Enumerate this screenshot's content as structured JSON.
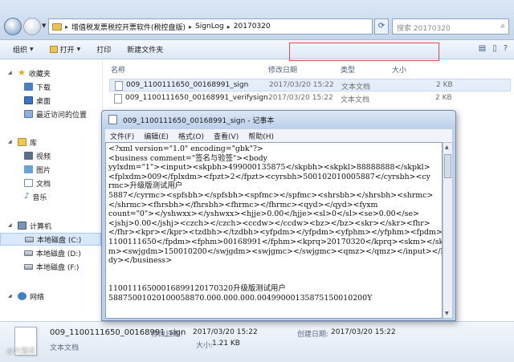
{
  "address": {
    "segments": [
      "增值税发票税控开票软件(税控盘版)",
      "SignLog",
      "20170320"
    ],
    "search_placeholder": "搜索 20170320"
  },
  "toolbar": {
    "organize": "组织",
    "open": "打开",
    "print": "打印",
    "new_folder": "新建文件夹"
  },
  "sidebar": {
    "favorites": "收藏夹",
    "downloads": "下载",
    "desktop": "桌面",
    "recent": "最近访问的位置",
    "libraries": "库",
    "videos": "视频",
    "pictures": "图片",
    "documents": "文档",
    "music": "音乐",
    "computer": "计算机",
    "drive_c": "本地磁盘 (C:)",
    "drive_d": "本地磁盘 (D:)",
    "drive_f": "本地磁盘 (F:)",
    "network": "网络"
  },
  "columns": {
    "name": "名称",
    "date": "修改日期",
    "type": "类型",
    "size": "大小"
  },
  "files": [
    {
      "name": "009_1100111650_00168991_sign",
      "date": "2017/03/20 15:22",
      "type": "文本文档",
      "size": "2 KB"
    },
    {
      "name": "009_1100111650_00168991_verifysign",
      "date": "2017/03/20 15:22",
      "type": "文本文档",
      "size": "2 KB"
    }
  ],
  "notepad": {
    "title": "009_1100111650_00168991_sign - 记事本",
    "menu": [
      "文件(F)",
      "编辑(E)",
      "格式(O)",
      "查看(V)",
      "帮助(H)"
    ],
    "lines": [
      "<?xml version=\"1.0\" encoding=\"gbk\"?>",
      "<business comment=\"签名与验签\"><body",
      "yylxdm=\"1\"><input><skpbh>499000135875</skpbh><skpkl>88888888</skpkl>",
      "<fplxdm>009</fplxdm><fpzt>2</fpzt><cyrsbh>500102010005887</cyrsbh><cy",
      "rmc>升级版测试用户",
      "5887</cyrmc><spfsbh></spfsbh><spfmc></spfmc><shrsbh></shrsbh><shrmc>",
      "</shrmc><fhrsbh></fhrsbh><fhrmc></fhrmc><qyd></qyd><fyxm",
      "count=\"0\"></yshwxx></yshwxx><hjje>0.00</hjje><sl>0</sl><se>0.00</se>",
      "<jshj>0.00</jshj><czch></czch><ccdw></ccdw><bz></bz><skr></skr><fhr>",
      "</fhr><kpr></kpr><tzdbh></tzdbh><yfpdm></yfpdm><yfphm></yfphm><fpdm>",
      "1100111650</fpdm><fphm>00168991</fphm><kprq>20170320</kprq><skm></sk",
      "m><swjgdm>150010200</swjgdm><swjgmc></swjgmc><qmz></qmz></input></bo",
      "dy></business>",
      "",
      "",
      "1100111650001689912017032​0升级版测试用户",
      "5887500102010005887​0.000.000.000.00499000135875150010200Y"
    ]
  },
  "details": {
    "name": "009_1100111650_00168991_sign",
    "type": "文本文档",
    "modified_label": "修改日期:",
    "modified": "2017/03/20 15:22",
    "created_label": "创建日期:",
    "created": "2017/03/20 15:22",
    "size_label": "大小:",
    "size": "1.21 KB"
  },
  "watermark": "@大猫说"
}
